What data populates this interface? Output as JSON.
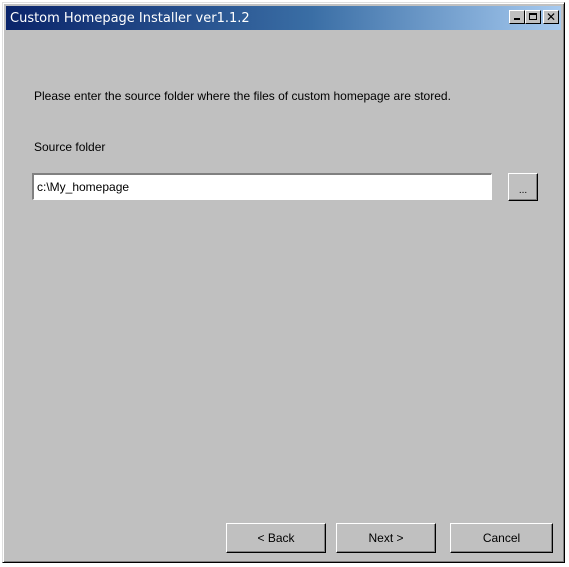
{
  "window": {
    "title": "Custom Homepage Installer ver1.1.2",
    "controls": {
      "minimize": "minimize-icon",
      "maximize": "maximize-icon",
      "close": "close-icon",
      "close_glyph": "✕"
    }
  },
  "content": {
    "instruction": "Please enter the source folder where the files of custom homepage are stored.",
    "source_folder_label": "Source folder",
    "source_folder_value": "c:\\My_homepage",
    "browse_label": "..."
  },
  "buttons": {
    "back": "< Back",
    "next": "Next >",
    "cancel": "Cancel"
  }
}
